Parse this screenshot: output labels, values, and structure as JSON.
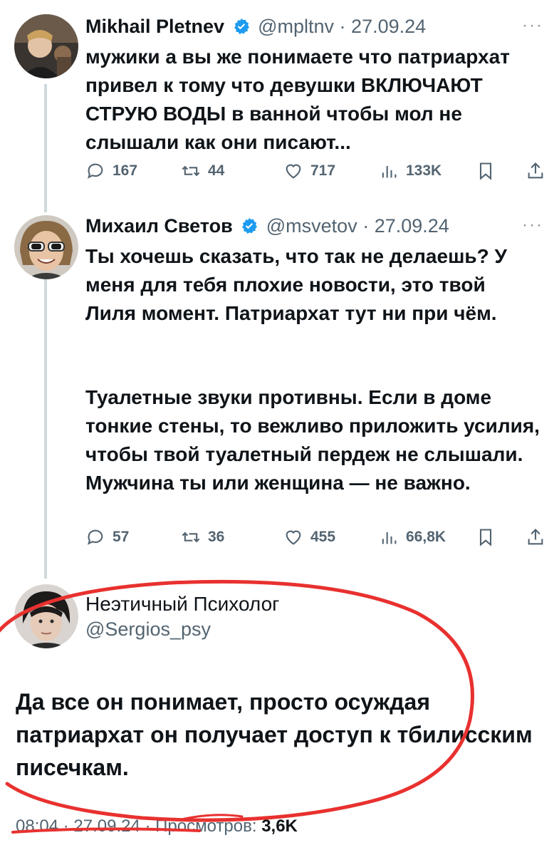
{
  "tweet1": {
    "name": "Mikhail Pletnev",
    "handle": "@mpltnv",
    "date": "27.09.24",
    "text": "мужики а вы же понимаете что патриархат привел к тому что девушки ВКЛЮЧАЮТ СТРУЮ ВОДЫ в ванной чтобы мол не слышали как они писают...",
    "replies": "167",
    "retweets": "44",
    "likes": "717",
    "views": "133K"
  },
  "tweet2": {
    "name": "Михаил Светов",
    "handle": "@msvetov",
    "date": "27.09.24",
    "paragraph1": "Ты хочешь сказать, что так не делаешь? У меня для тебя плохие новости, это твой Лиля момент. Патриархат тут ни при чём.",
    "paragraph2": "Туалетные звуки противны. Если в доме тонкие стены, то вежливо приложить усилия, чтобы твой туалетный пердеж не слышали. Мужчина ты или женщина — не важно.",
    "replies": "57",
    "retweets": "36",
    "likes": "455",
    "views": "66,8K"
  },
  "tweet3": {
    "name": "Неэтичный Психолог",
    "handle": "@Sergios_psy",
    "text": "Да все он понимает, просто осуждая патриархат он получает доступ к тбилисским писечкам.",
    "time": "08:04",
    "date": "27.09.24",
    "views_label": "Просмотров:",
    "views": "3,6K"
  },
  "colors": {
    "verified": "#1d9bf0",
    "annotation": "#e8312f",
    "muted": "#536471"
  },
  "icons": [
    "verified-badge-icon",
    "more-icon",
    "reply-icon",
    "retweet-icon",
    "like-icon",
    "views-icon",
    "bookmark-icon",
    "share-icon"
  ]
}
